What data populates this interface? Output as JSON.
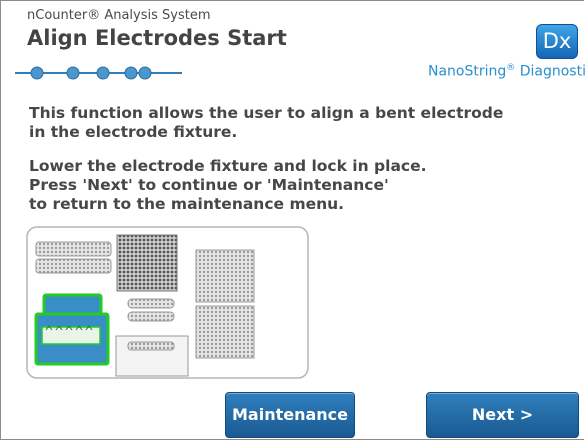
{
  "header": {
    "app_name": "nCounter® Analysis System",
    "title": "Align Electrodes Start",
    "logo_text": "Dx",
    "brand_name": "NanoString",
    "brand_mark": "®",
    "brand_suffix": "Diagnostics"
  },
  "progress": {
    "total_steps": 5,
    "icon": "step-dots-icon"
  },
  "content": {
    "paragraph1": [
      "This function allows the user to align a bent electrode",
      "in the electrode fixture."
    ],
    "paragraph2": [
      "Lower the electrode fixture and lock in place.",
      "Press 'Next' to continue or 'Maintenance'",
      "to return to the maintenance menu."
    ]
  },
  "illustration": {
    "icon": "prep-station-deck-icon",
    "highlight_color": "#22cc22"
  },
  "buttons": {
    "maintenance_label": "Maintenance",
    "next_label": "Next  >"
  },
  "colors": {
    "accent": "#2a8fd1",
    "button": "#1f6aa6",
    "highlight": "#22cc22"
  }
}
